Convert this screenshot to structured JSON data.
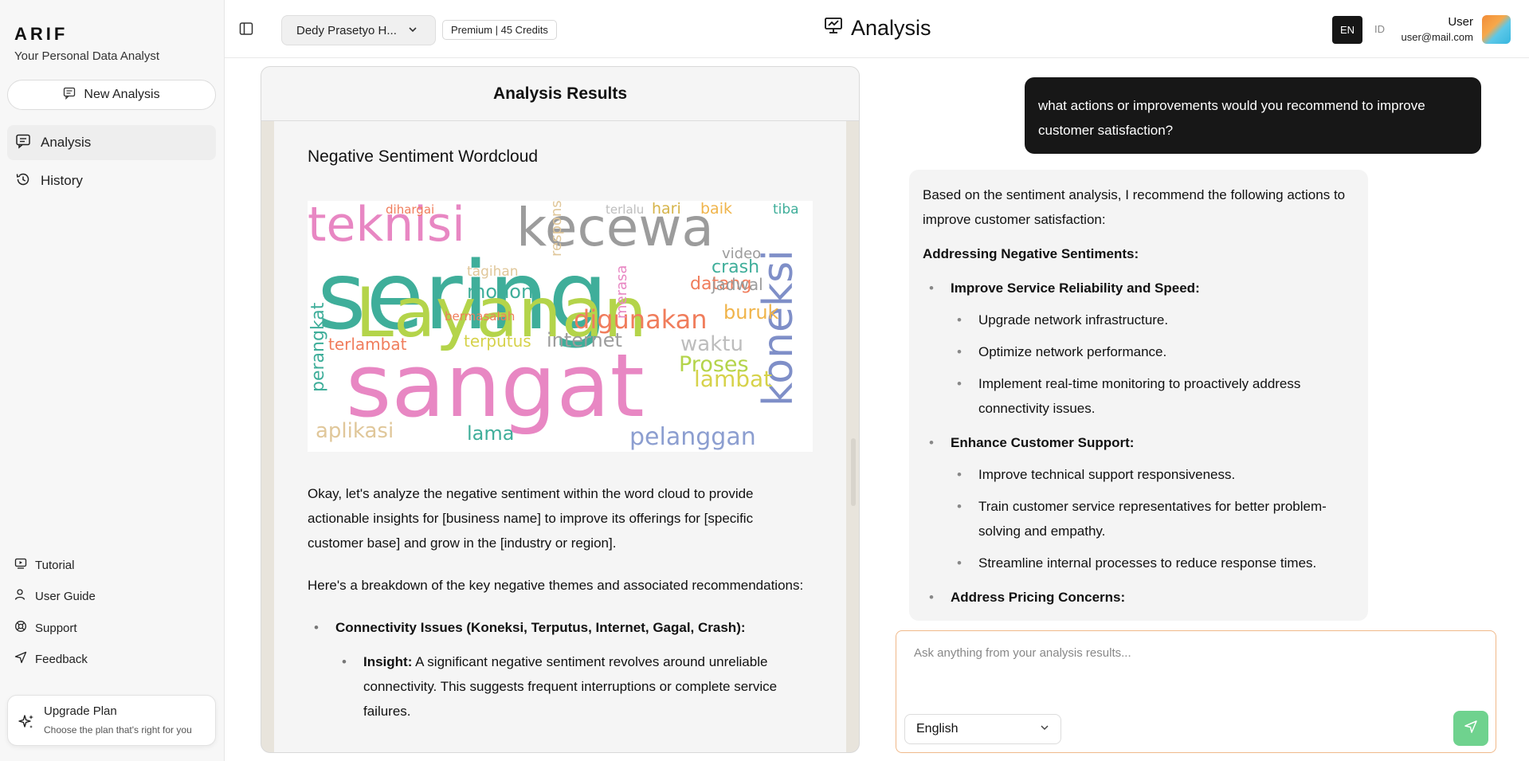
{
  "brand": {
    "logo": "ARIF",
    "tagline": "Your Personal Data Analyst"
  },
  "sidebar": {
    "new_analysis": "New Analysis",
    "nav": [
      {
        "label": "Analysis"
      },
      {
        "label": "History"
      }
    ],
    "links": [
      {
        "label": "Tutorial"
      },
      {
        "label": "User Guide"
      },
      {
        "label": "Support"
      },
      {
        "label": "Feedback"
      }
    ],
    "upgrade": {
      "title": "Upgrade Plan",
      "subtitle": "Choose the plan that's right for you"
    }
  },
  "header": {
    "user_select": "Dedy Prasetyo H...",
    "credits": "Premium | 45 Credits",
    "title": "Analysis",
    "lang_en": "EN",
    "lang_id": "ID",
    "user_name": "User",
    "user_email": "user@mail.com"
  },
  "results": {
    "heading": "Analysis Results",
    "wordcloud_title": "Negative Sentiment Wordcloud",
    "wordcloud_words": [
      {
        "text": "sering",
        "color": "#3fae9a"
      },
      {
        "text": "sangat",
        "color": "#e887c3"
      },
      {
        "text": "Layanan",
        "color": "#b4d44a"
      },
      {
        "text": "kecewa",
        "color": "#9c9c9c"
      },
      {
        "text": "teknisi",
        "color": "#e887c3"
      },
      {
        "text": "koneksi",
        "color": "#7f8fc8"
      },
      {
        "text": "digunakan",
        "color": "#f07d5c"
      },
      {
        "text": "internet",
        "color": "#9c9c9c"
      },
      {
        "text": "terputus",
        "color": "#d6d24a"
      },
      {
        "text": "lambat",
        "color": "#d6d24a"
      },
      {
        "text": "pelanggan",
        "color": "#8c9ed0"
      },
      {
        "text": "Proses",
        "color": "#b4d44a"
      },
      {
        "text": "waktu",
        "color": "#bdbdbd"
      },
      {
        "text": "aplikasi",
        "color": "#e0c79a"
      },
      {
        "text": "lama",
        "color": "#3fae9a"
      },
      {
        "text": "terlambat",
        "color": "#f07d5c"
      },
      {
        "text": "datang",
        "color": "#f07d5c"
      },
      {
        "text": "buruk",
        "color": "#f0b44a"
      },
      {
        "text": "mohon",
        "color": "#3fae9a"
      },
      {
        "text": "crash",
        "color": "#3fae9a"
      },
      {
        "text": "perangkat",
        "color": "#3fae9a"
      },
      {
        "text": "jadwal",
        "color": "#9c9c9c"
      },
      {
        "text": "respons",
        "color": "#e0c79a"
      },
      {
        "text": "hari",
        "color": "#d6b44a"
      },
      {
        "text": "baik",
        "color": "#f0b44a"
      },
      {
        "text": "tiba",
        "color": "#3fae9a"
      },
      {
        "text": "tagihan",
        "color": "#e0c79a"
      },
      {
        "text": "merasa",
        "color": "#e887c3"
      },
      {
        "text": "bermasalah",
        "color": "#f07d5c"
      },
      {
        "text": "video",
        "color": "#9c9c9c"
      },
      {
        "text": "dihargai",
        "color": "#f07d5c"
      },
      {
        "text": "terlalu",
        "color": "#bdbdbd"
      }
    ],
    "intro": "Okay, let's analyze the negative sentiment within the word cloud to provide actionable insights for [business name] to improve its offerings for [specific customer base] and grow in the [industry or region].",
    "breakdown": "Here's a breakdown of the key negative themes and associated recommendations:",
    "theme1": "Connectivity Issues (Koneksi, Terputus, Internet, Gagal, Crash):",
    "insight_label": "Insight:",
    "insight_text": " A significant negative sentiment revolves around unreliable connectivity. This suggests frequent interruptions or complete service failures."
  },
  "chat": {
    "user_message": "what actions or improvements would you recommend to improve customer satisfaction?",
    "ai_intro": "Based on the sentiment analysis, I recommend the following actions to improve customer satisfaction:",
    "ai_heading": "Addressing Negative Sentiments:",
    "sections": [
      {
        "title": "Improve Service Reliability and Speed:",
        "items": [
          "Upgrade network infrastructure.",
          "Optimize network performance.",
          "Implement real-time monitoring to proactively address connectivity issues."
        ]
      },
      {
        "title": "Enhance Customer Support:",
        "items": [
          "Improve technical support responsiveness.",
          "Train customer service representatives for better problem-solving and empathy.",
          "Streamline internal processes to reduce response times."
        ]
      },
      {
        "title": "Address Pricing Concerns:",
        "items": []
      }
    ],
    "input_placeholder": "Ask anything from your analysis results...",
    "language": "English"
  }
}
